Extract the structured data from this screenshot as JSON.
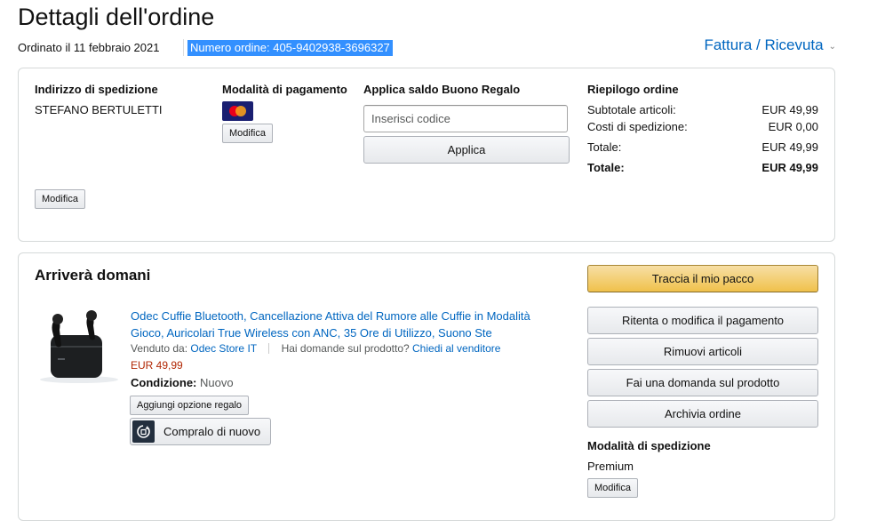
{
  "header": {
    "title": "Dettagli dell'ordine",
    "order_date": "Ordinato il 11 febbraio 2021",
    "order_number": "Numero ordine: 405-9402938-3696327",
    "invoice_link": "Fattura / Ricevuta"
  },
  "shipping_address": {
    "heading": "Indirizzo di spedizione",
    "name": "STEFANO BERTULETTI",
    "edit_label": "Modifica"
  },
  "payment": {
    "heading": "Modalità di pagamento",
    "card_icon": "mastercard-icon",
    "card_text": "MasterCard",
    "edit_label": "Modifica"
  },
  "gift_card": {
    "heading": "Applica saldo Buono Regalo",
    "placeholder": "Inserisci codice",
    "apply_label": "Applica"
  },
  "summary": {
    "heading": "Riepilogo ordine",
    "rows": [
      {
        "label": "Subtotale articoli:",
        "value": "EUR 49,99"
      },
      {
        "label": "Costi di spedizione:",
        "value": "EUR 0,00"
      },
      {
        "label": "Totale:",
        "value": "EUR 49,99"
      },
      {
        "label": "Totale:",
        "value": "EUR 49,99"
      }
    ]
  },
  "shipment": {
    "status": "Arriverà domani",
    "product_title": "Odec Cuffie Bluetooth, Cancellazione Attiva del Rumore alle Cuffie in Modalità Gioco, Auricolari True Wireless con ANC, 35 Ore di Utilizzo, Suono Ste",
    "sold_by_label": "Venduto da:",
    "seller": "Odec Store IT",
    "question_label": "Hai domande sul prodotto?",
    "ask_seller": "Chiedi al venditore",
    "price": "EUR 49,99",
    "condition_label": "Condizione:",
    "condition_value": "Nuovo",
    "gift_option_label": "Aggiungi opzione regalo",
    "buy_again_label": "Compralo di nuovo",
    "actions": {
      "track": "Traccia il mio pacco",
      "retry_payment": "Ritenta o modifica il pagamento",
      "remove_items": "Rimuovi articoli",
      "ask_question": "Fai una domanda sul prodotto",
      "archive": "Archivia ordine"
    },
    "shipping_method_heading": "Modalità di spedizione",
    "shipping_method": "Premium",
    "shipping_edit_label": "Modifica"
  },
  "colors": {
    "link": "#0066c0",
    "price": "#b12704",
    "primary_button": "#f0c14b",
    "selection": "#3390ff"
  }
}
